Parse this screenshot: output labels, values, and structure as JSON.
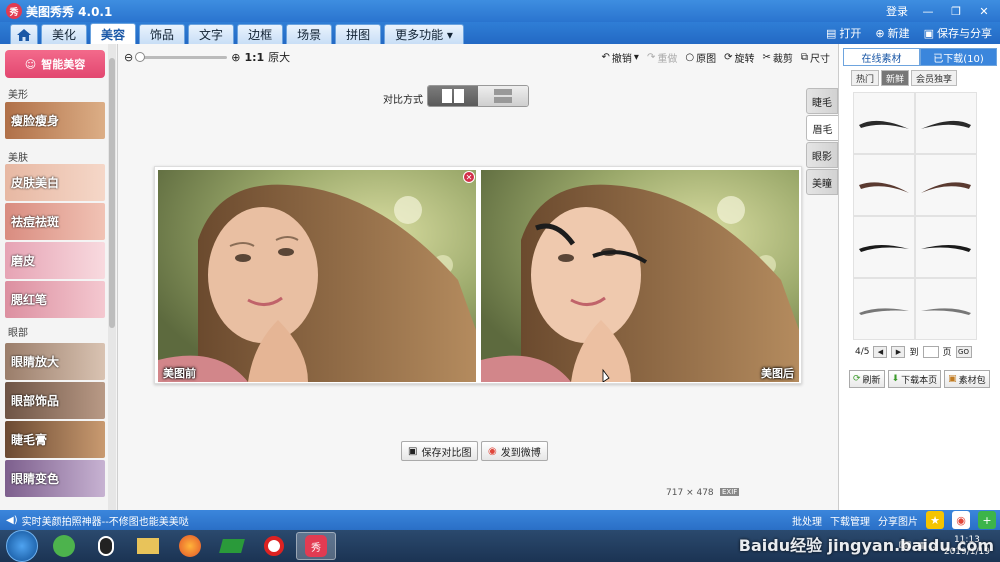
{
  "app": {
    "title": "美图秀秀 4.0.1",
    "logo_text": "秀"
  },
  "titlebar": {
    "login": "登录",
    "minimize": "—",
    "restore": "❐",
    "close": "✕"
  },
  "tabs": [
    "美化",
    "美容",
    "饰品",
    "文字",
    "边框",
    "场景",
    "拼图",
    "更多功能 ▾"
  ],
  "active_tab": "美容",
  "tabbar_actions": {
    "open": "打开",
    "new": "新建",
    "save_share": "保存与分享"
  },
  "left_panel": {
    "smart_button": "智能美容",
    "sections": [
      {
        "label": "美形",
        "items": [
          "瘦脸瘦身"
        ]
      },
      {
        "label": "美肤",
        "items": [
          "皮肤美白",
          "祛痘祛斑",
          "磨皮",
          "腮红笔"
        ]
      },
      {
        "label": "眼部",
        "items": [
          "眼睛放大",
          "眼部饰品",
          "睫毛膏",
          "眼睛变色"
        ]
      }
    ]
  },
  "toolbar": {
    "zoom_ratio": "1:1",
    "original_size": "原大",
    "undo": "撤销",
    "redo": "重做",
    "original": "原图",
    "rotate": "旋转",
    "crop": "裁剪",
    "size": "尺寸"
  },
  "compare": {
    "label": "对比方式"
  },
  "photos": {
    "before_label": "美图前",
    "after_label": "美图后"
  },
  "buttons": {
    "save_compare": "保存对比图",
    "post_weibo": "发到微博"
  },
  "image_info": {
    "width": "717",
    "sep": "×",
    "height": "478",
    "exif": "EXIF"
  },
  "side_tabs": [
    "睫毛",
    "眉毛",
    "眼影",
    "美瞳"
  ],
  "active_side_tab": "眉毛",
  "right_panel": {
    "tabs": [
      "在线素材",
      "已下载(10)"
    ],
    "subtabs": [
      "热门",
      "新鲜",
      "会员独享"
    ],
    "active_subtab": "新鲜",
    "pager": {
      "current": "4/5",
      "goto_label": "到",
      "page_unit": "页",
      "go": "GO"
    },
    "actions": [
      "刷新",
      "下载本页",
      "素材包"
    ]
  },
  "statusbar": {
    "tip": "实时美颜拍照神器--不修图也能美美哒",
    "batch": "批处理",
    "downloads": "下载管理",
    "share": "分享图片"
  },
  "taskbar": {
    "time": "11:13",
    "date": "2019/1/19"
  },
  "watermark": "Baidu经验 jingyan.baidu.com",
  "colors": {
    "accent": "#2a74cf",
    "smart_button": "#e84a72"
  }
}
